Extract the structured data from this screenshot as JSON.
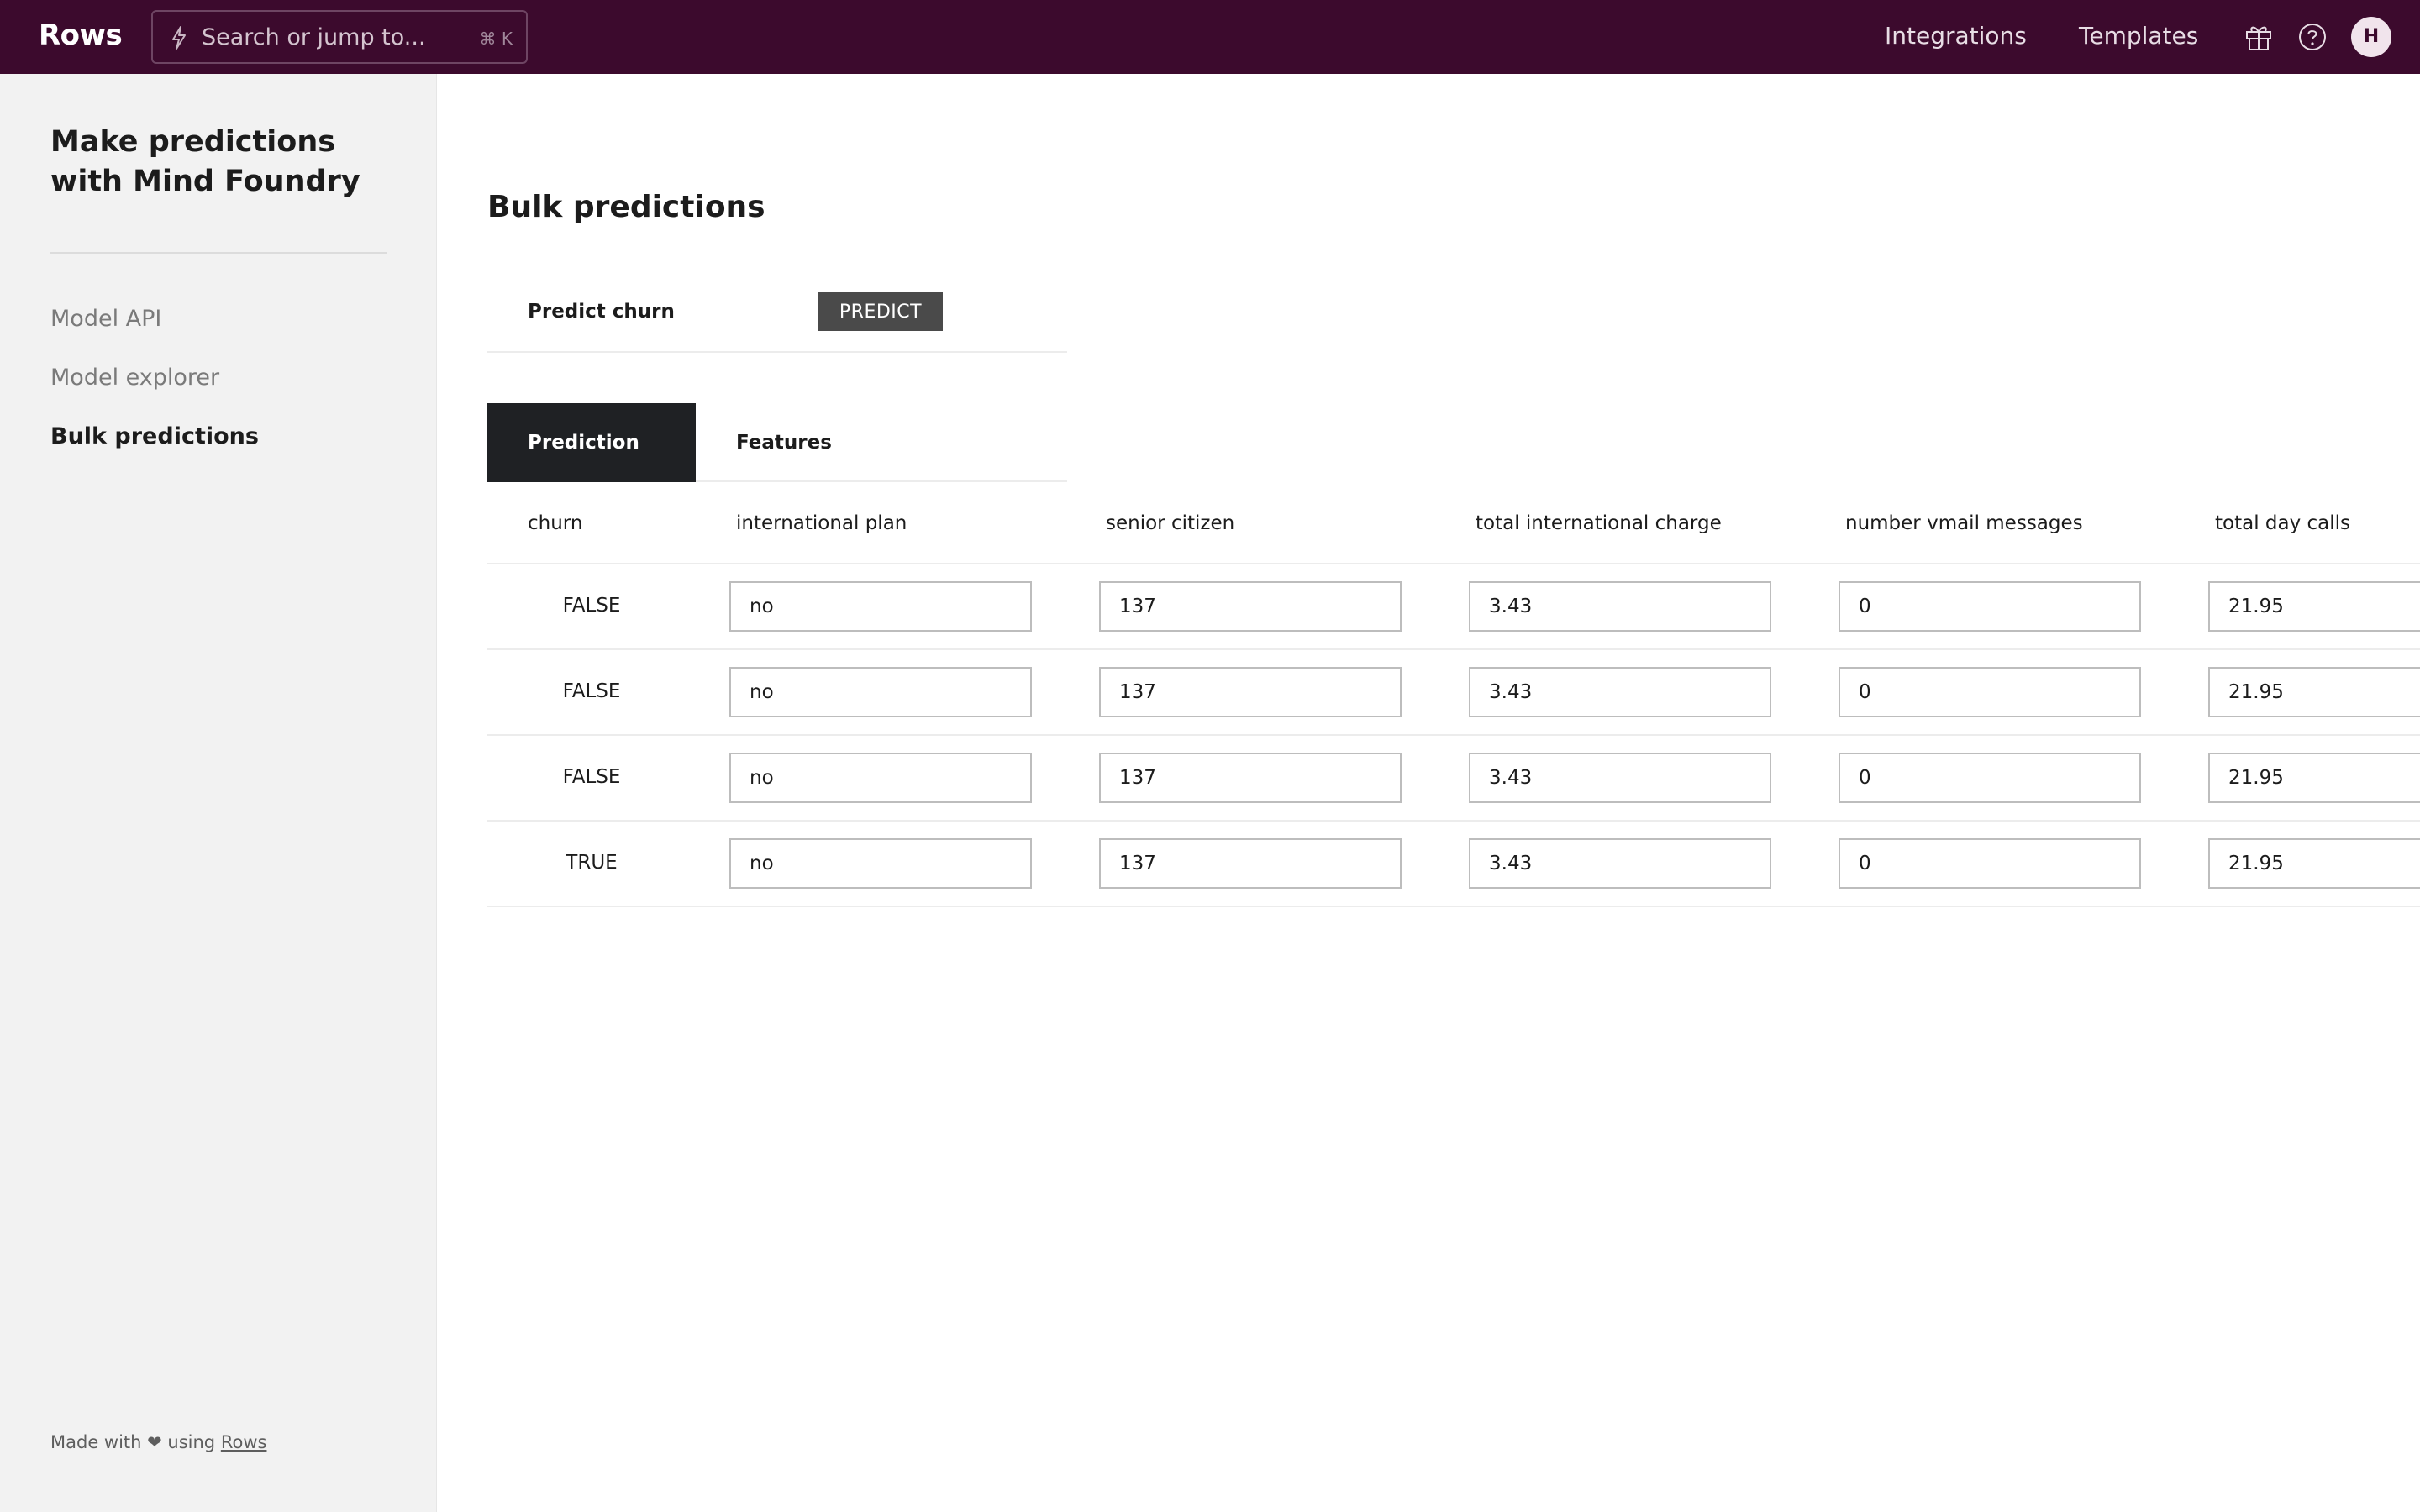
{
  "topbar": {
    "logo": "Rows",
    "search_placeholder": "Search or jump to...",
    "search_shortcut": "⌘ K",
    "nav": [
      "Integrations",
      "Templates"
    ],
    "avatar_initial": "H",
    "background": "#3c0a2d"
  },
  "sidebar": {
    "title": "Make predictions with Mind Foundry",
    "items": [
      {
        "label": "Model API",
        "active": false
      },
      {
        "label": "Model explorer",
        "active": false
      },
      {
        "label": "Bulk predictions",
        "active": true
      }
    ],
    "footer": {
      "prefix": "Made with ❤ using",
      "link": "Rows"
    }
  },
  "main": {
    "title": "Bulk predictions",
    "predict_label": "Predict churn",
    "predict_button": "PREDICT",
    "tabs": [
      {
        "label": "Prediction",
        "active": true
      },
      {
        "label": "Features",
        "active": false
      }
    ],
    "table": {
      "headers": [
        "churn",
        "international plan",
        "senior citizen",
        "total international charge",
        "number vmail messages",
        "total day calls"
      ],
      "rows": [
        {
          "churn": "FALSE",
          "cells": [
            "no",
            "137",
            "3.43",
            "0",
            "21.95"
          ]
        },
        {
          "churn": "FALSE",
          "cells": [
            "no",
            "137",
            "3.43",
            "0",
            "21.95"
          ]
        },
        {
          "churn": "FALSE",
          "cells": [
            "no",
            "137",
            "3.43",
            "0",
            "21.95"
          ]
        },
        {
          "churn": "TRUE",
          "cells": [
            "no",
            "137",
            "3.43",
            "0",
            "21.95"
          ]
        }
      ]
    }
  }
}
